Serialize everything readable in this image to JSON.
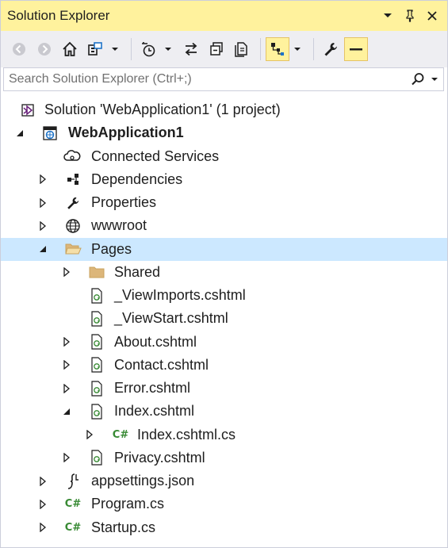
{
  "window": {
    "title": "Solution Explorer"
  },
  "search": {
    "placeholder": "Search Solution Explorer (Ctrl+;)"
  },
  "tree": {
    "solution": "Solution 'WebApplication1' (1 project)",
    "project": "WebApplication1",
    "connected_services": "Connected Services",
    "dependencies": "Dependencies",
    "properties": "Properties",
    "wwwroot": "wwwroot",
    "pages": "Pages",
    "shared": "Shared",
    "viewimports": "_ViewImports.cshtml",
    "viewstart": "_ViewStart.cshtml",
    "about": "About.cshtml",
    "contact": "Contact.cshtml",
    "error": "Error.cshtml",
    "index": "Index.cshtml",
    "index_cs": "Index.cshtml.cs",
    "privacy": "Privacy.cshtml",
    "appsettings": "appsettings.json",
    "program": "Program.cs",
    "startup": "Startup.cs"
  },
  "colors": {
    "title_bg": "#fff29d",
    "toolbar_bg": "#eeeef2",
    "selected_row": "#cce8ff",
    "csharp_icon": "#388a34",
    "project_icon": "#1e73c8"
  }
}
